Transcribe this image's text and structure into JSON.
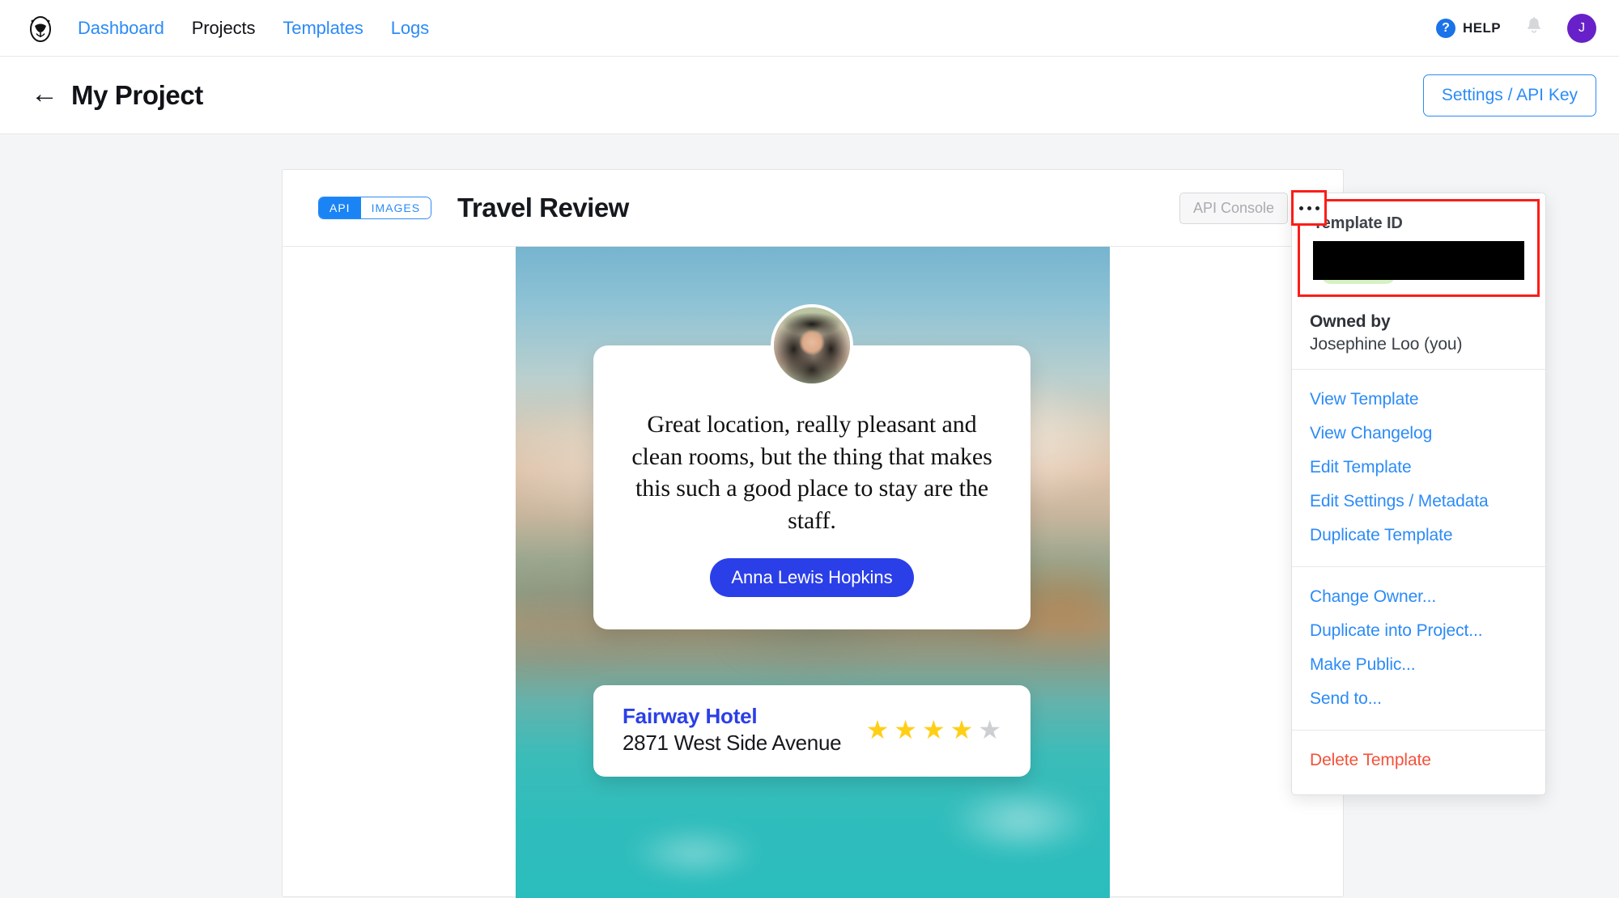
{
  "nav": {
    "logo_icon": "egg-avocado-logo",
    "links": [
      {
        "label": "Dashboard",
        "active": false
      },
      {
        "label": "Projects",
        "active": true
      },
      {
        "label": "Templates",
        "active": false
      },
      {
        "label": "Logs",
        "active": false
      }
    ],
    "help": {
      "icon": "question-mark-icon",
      "label": "HELP"
    },
    "notifications_icon": "bell-icon",
    "avatar_initial": "J"
  },
  "project_header": {
    "back_icon": "back-arrow-icon",
    "title": "My Project",
    "settings_button": "Settings / API Key"
  },
  "template_card": {
    "segment": {
      "options": [
        "API",
        "IMAGES"
      ],
      "selected": "API"
    },
    "title": "Travel Review",
    "api_console_button": "API Console",
    "more_button_icon": "ellipsis-icon"
  },
  "preview": {
    "quote": "Great location, really pleasant and clean rooms, but the thing that makes this such a good place to stay are the staff.",
    "author": "Anna Lewis Hopkins",
    "avatar_icon": "person-photo-avatar",
    "hotel_name": "Fairway Hotel",
    "hotel_address": "2871 West Side Avenue",
    "rating_filled": 4,
    "rating_total": 5,
    "star_filled_color": "#ffcf17",
    "star_empty_color": "#cdd0d3"
  },
  "menu": {
    "template_id_label": "Template ID",
    "template_id_value": "",
    "owned_by_label": "Owned by",
    "owner_name": "Josephine Loo (you)",
    "items": [
      "View Template",
      "View Changelog",
      "Edit Template",
      "Edit Settings / Metadata",
      "Duplicate Template"
    ],
    "items2": [
      "Change Owner...",
      "Duplicate into Project...",
      "Make Public...",
      "Send to..."
    ],
    "delete_label": "Delete Template"
  },
  "colors": {
    "link_blue": "#2b8bf7",
    "accent_blue": "#1a84f5",
    "brand_indigo": "#2b3fe8",
    "danger_red": "#f4513a",
    "highlight_red": "#fc1d18",
    "avatar_purple": "#6821c8",
    "page_bg": "#f4f5f6"
  }
}
